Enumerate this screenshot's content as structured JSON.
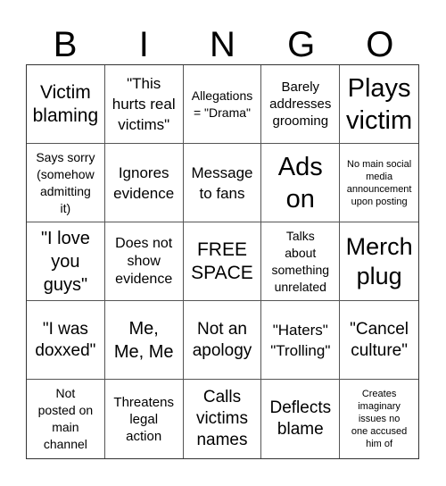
{
  "header": {
    "letters": [
      "B",
      "I",
      "N",
      "G",
      "O"
    ]
  },
  "cells": [
    {
      "text": "Victim\nblaming"
    },
    {
      "text": "\"This\nhurts real\nvictims\""
    },
    {
      "text": "Allegations\n= \"Drama\""
    },
    {
      "text": "Barely\naddresses\ngrooming"
    },
    {
      "text": "Plays\nvictim"
    },
    {
      "text": "Says sorry\n(somehow\nadmitting\nit)"
    },
    {
      "text": "Ignores\nevidence"
    },
    {
      "text": "Message\nto fans"
    },
    {
      "text": "Ads\non"
    },
    {
      "text": "No main social\nmedia\nannouncement\nupon posting"
    },
    {
      "text": "\"I love\nyou\nguys\""
    },
    {
      "text": "Does not\nshow\nevidence"
    },
    {
      "text": "FREE\nSPACE"
    },
    {
      "text": "Talks\nabout\nsomething\nunrelated"
    },
    {
      "text": "Merch\nplug"
    },
    {
      "text": "\"I was\ndoxxed\""
    },
    {
      "text": "Me,\nMe, Me"
    },
    {
      "text": "Not an\napology"
    },
    {
      "text": "\"Haters\"\n\"Trolling\""
    },
    {
      "text": "\"Cancel\nculture\""
    },
    {
      "text": "Not\nposted on\nmain\nchannel"
    },
    {
      "text": "Threatens\nlegal\naction"
    },
    {
      "text": "Calls\nvictims\nnames"
    },
    {
      "text": "Deflects\nblame"
    },
    {
      "text": "Creates\nimaginary\nissues no\none accused\nhim of"
    }
  ]
}
